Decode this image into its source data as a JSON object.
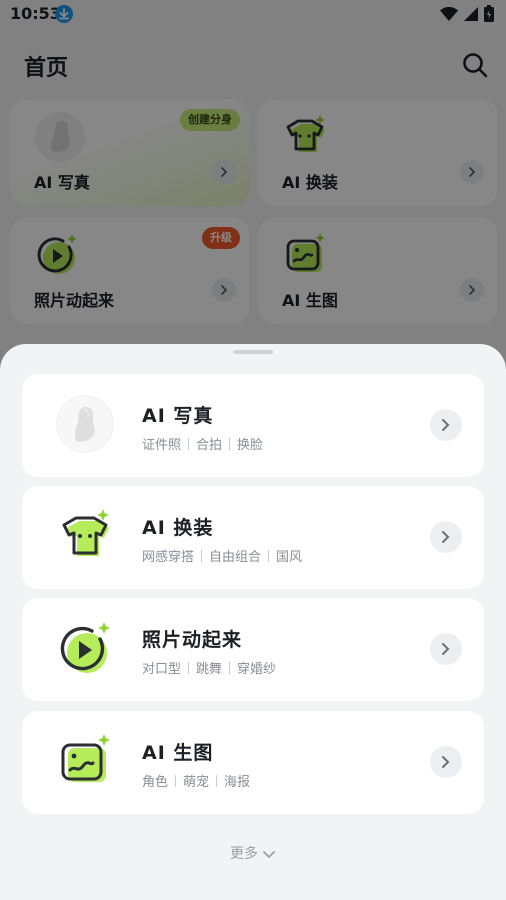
{
  "status_bar": {
    "time": "10:53"
  },
  "page": {
    "title": "首页",
    "tiles": [
      {
        "label": "AI 写真",
        "badge": "创建分身"
      },
      {
        "label": "AI 换装"
      },
      {
        "label": "照片动起来",
        "badge": "升级"
      },
      {
        "label": "AI 生图"
      }
    ]
  },
  "sheet": {
    "cards": [
      {
        "title": "AI 写真",
        "tags": [
          "证件照",
          "合拍",
          "换脸"
        ]
      },
      {
        "title": "AI 换装",
        "tags": [
          "网感穿搭",
          "自由组合",
          "国风"
        ]
      },
      {
        "title": "照片动起来",
        "tags": [
          "对口型",
          "跳舞",
          "穿婚纱"
        ]
      },
      {
        "title": "AI 生图",
        "tags": [
          "角色",
          "萌宠",
          "海报"
        ]
      }
    ],
    "more_label": "更多"
  },
  "colors": {
    "accent_green": "#b5ec5a",
    "badge_red": "#f45b2e",
    "download_blue": "#1e9bf0"
  }
}
